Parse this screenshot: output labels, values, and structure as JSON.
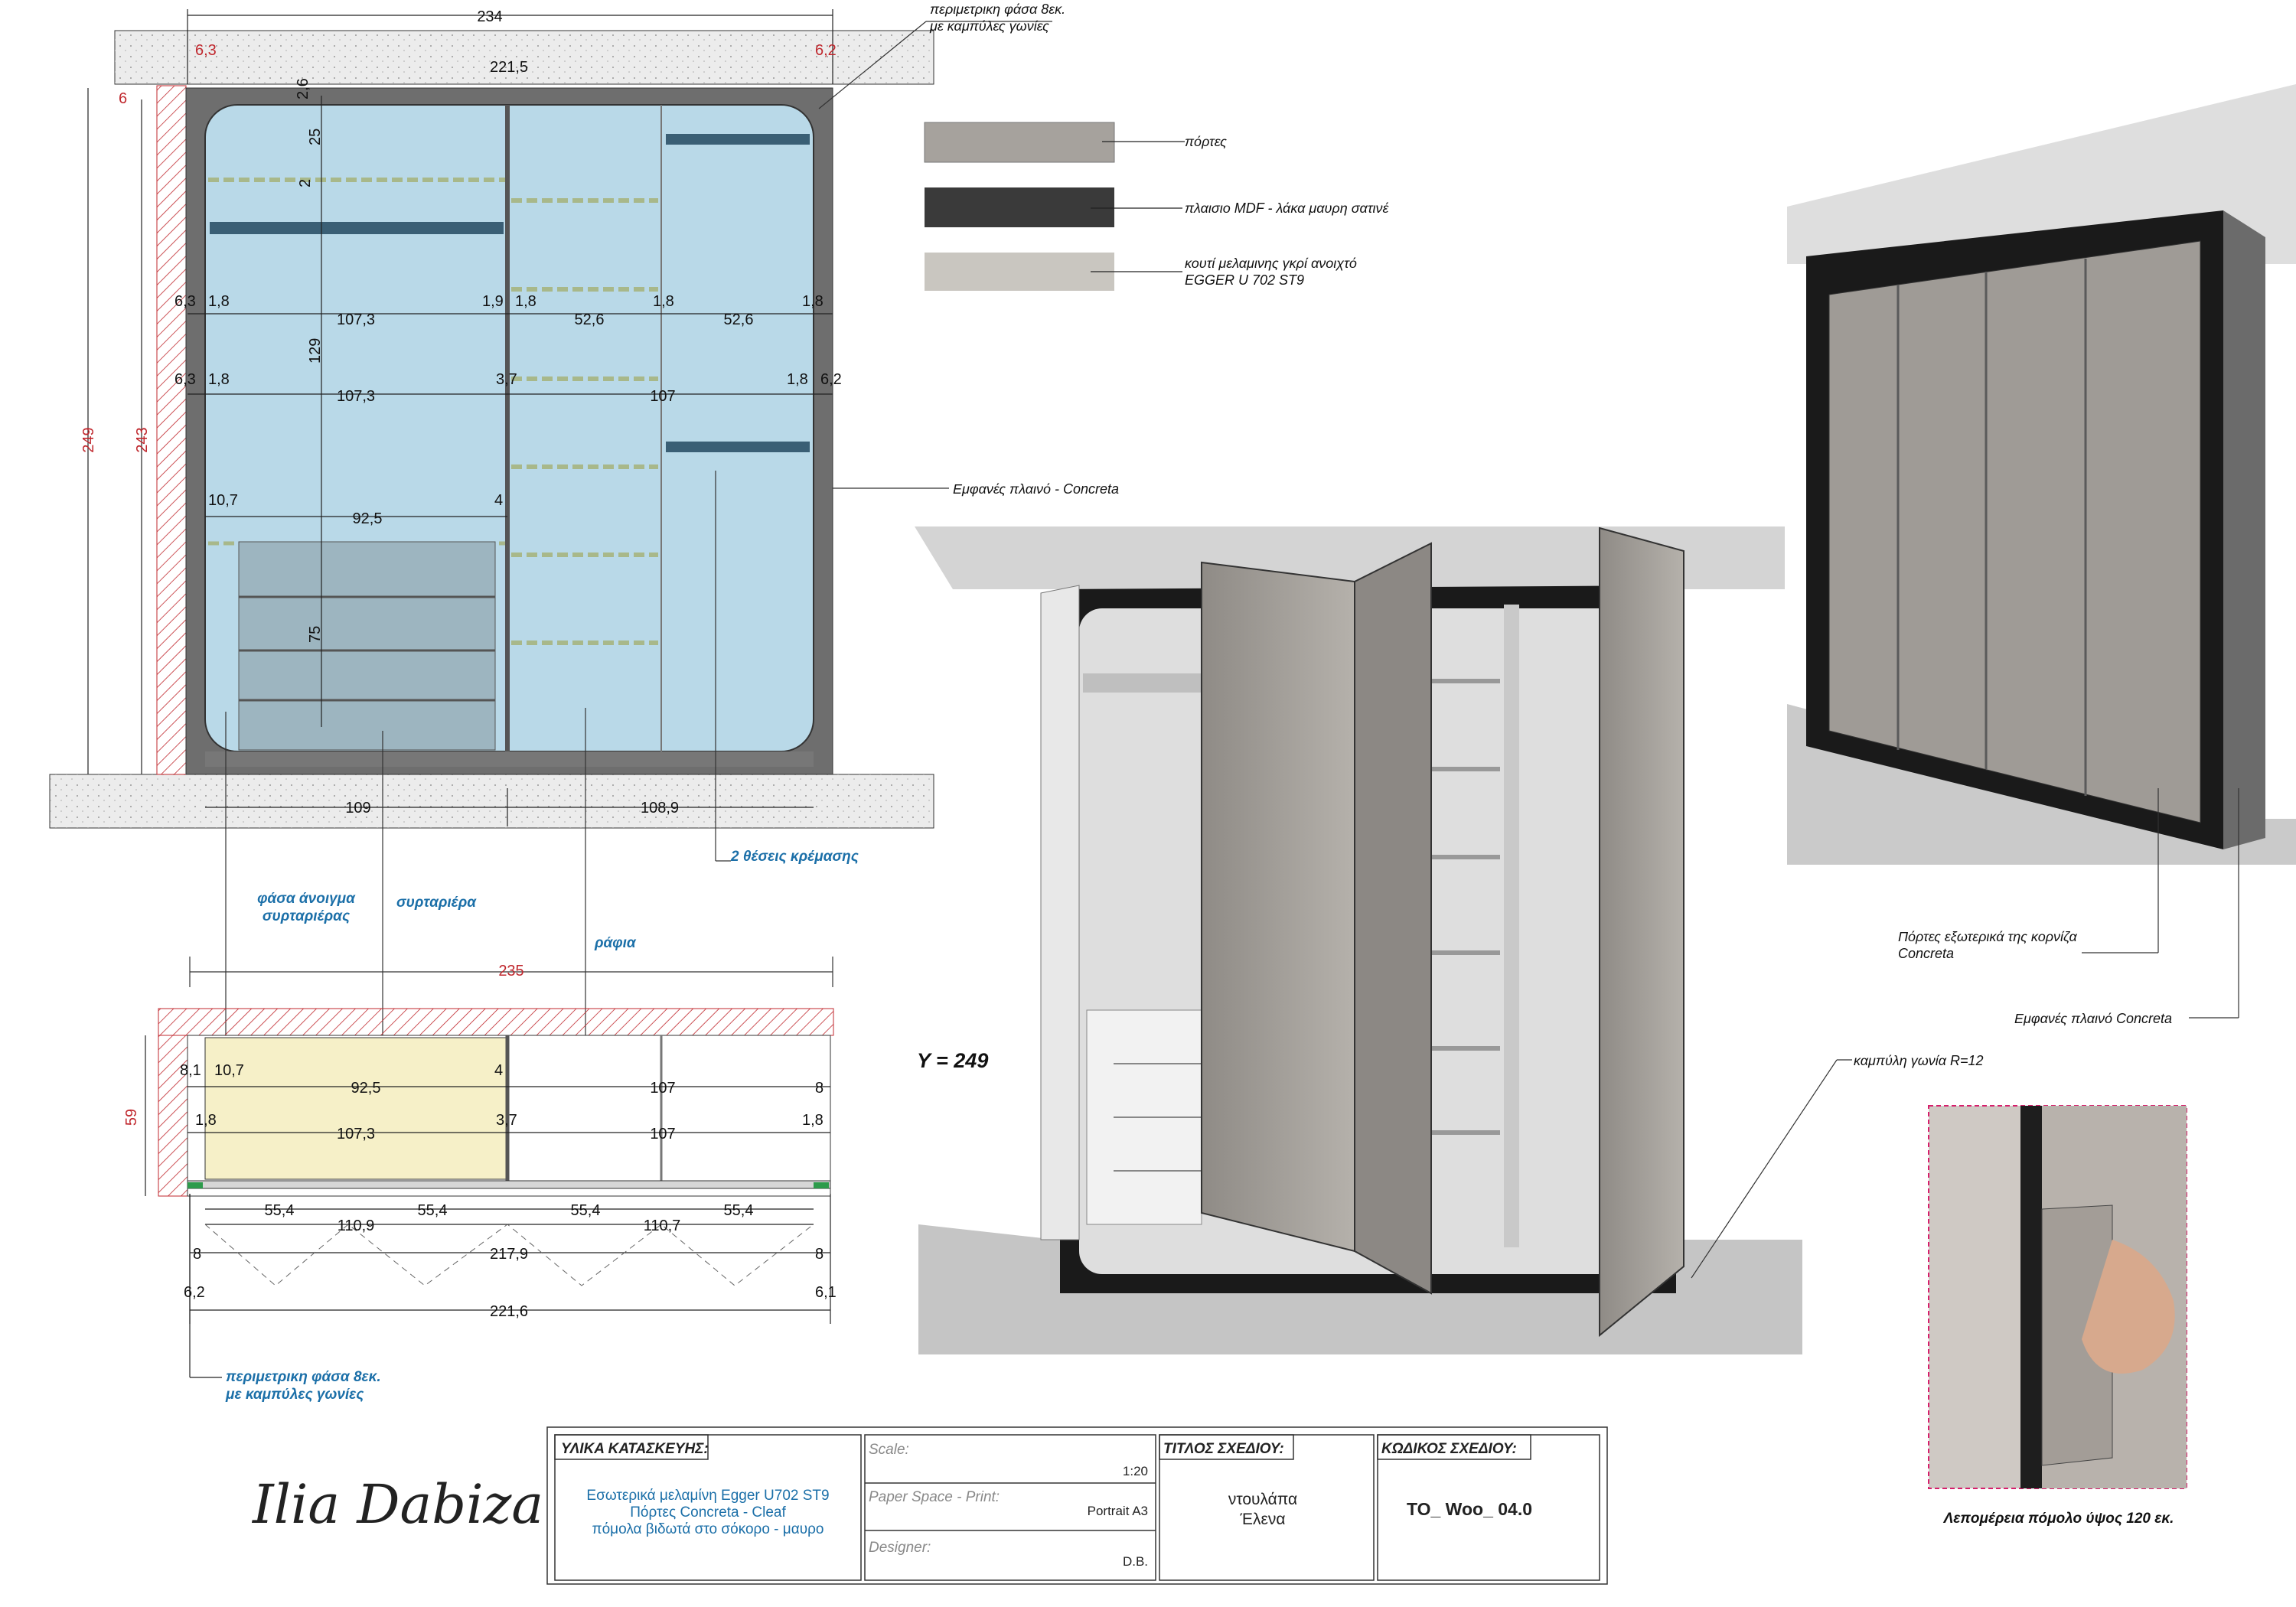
{
  "colors": {
    "glass": "#b9d9e8",
    "frame": "#6e6e6e",
    "hatch": "#c0272d",
    "concrete": "#a6a29d",
    "drawer_yellow": "#f6f0c8",
    "dim_red": "#c0272d",
    "note_blue": "#1b6fa8",
    "mdf_black": "#3a3a3a",
    "melamine": "#c9c6c0"
  },
  "front": {
    "overall": "234",
    "width_inner": "221,5",
    "left": "6,3",
    "right": "6,2",
    "top": "6",
    "h_total": "249",
    "h_inner": "243",
    "top_gap": "2,6",
    "shelf_h": "25",
    "shelf_gap": "2",
    "mid_h": "129",
    "drawer_h": "75",
    "row1": [
      "6,3",
      "1,8",
      "107,3",
      "1,9",
      "1,8",
      "52,6",
      "1,8",
      "52,6",
      "1,8"
    ],
    "row2": [
      "6,3",
      "1,8",
      "107,3",
      "3,7",
      "107",
      "1,8",
      "6,2"
    ],
    "row3": [
      "10,7",
      "92,5",
      "4"
    ],
    "bottom": [
      "109",
      "108,9"
    ]
  },
  "plan": {
    "overall": "235",
    "depth": "59",
    "r1": [
      "8,1",
      "10,7",
      "92,5",
      "4",
      "107",
      "8"
    ],
    "r2": [
      "1,8",
      "107,3",
      "3,7",
      "107",
      "1,8"
    ],
    "r3": [
      "55,4",
      "55,4",
      "55,4",
      "55,4"
    ],
    "r4": [
      "110,9",
      "110,7"
    ],
    "r5": [
      "8",
      "217,9",
      "8"
    ],
    "r6": [
      "6,2",
      "221,6",
      "6,1"
    ]
  },
  "notes": {
    "perim_top": [
      "περιμετρικη φάσα 8εκ.",
      "με καμπύλες γωνίες"
    ],
    "perim_bottom": [
      "περιμετρικη φάσα 8εκ.",
      "με καμπύλες γωνίες"
    ],
    "panel": "Εμφανές πλαινό - Concreta",
    "hanging": "2 θέσεις κρέμασης",
    "drawer_open": [
      "φάσα άνοιγμα",
      "συρταριέρας"
    ],
    "drawer": "συρταριέρα",
    "shelves": "ράφια",
    "y": "Y = 249",
    "corner": "καμπύλη γωνία  R=12",
    "ext_doors": [
      "Πόρτες  εξωτερικά της κορνίζα",
      "Concreta"
    ],
    "ext_panel": "Εμφανές πλαινό  Concreta",
    "detail": "Λεπομέρεια πόμολο ύψος 120 εκ."
  },
  "legend": [
    {
      "label": "πόρτες"
    },
    {
      "label": "πλαισιο MDF - λάκα μαυρη σατινέ"
    },
    {
      "label": "κουτί μελαμινης  γκρί ανοιχτό",
      "label2": "EGGER U 702 ST9"
    }
  ],
  "titleblock": {
    "materials_h": "ΥΛΙΚΑ ΚΑΤΑΣΚΕΥΗΣ:",
    "materials": [
      "Εσωτερικά μελαμίνη Egger  U702 ST9",
      "Πόρτες Concreta - Cleaf",
      "πόμολα βιδωτά στο σόκορο - μαυρο"
    ],
    "scale_l": "Scale:",
    "scale": "1:20",
    "paper_l": "Paper Space - Print:",
    "paper": "Portrait  A3",
    "designer_l": "Designer:",
    "designer": "D.B.",
    "title_l": "ΤΙΤΛΟΣ ΣΧΕΔΙΟΥ:",
    "title": [
      "ντουλάπα",
      "Έλενα"
    ],
    "code_l": "ΚΩΔΙΚΟΣ ΣΧΕΔΙΟΥ:",
    "code": "TO_ Woo_ 04.0",
    "signature": "Ilia Dabiza"
  }
}
